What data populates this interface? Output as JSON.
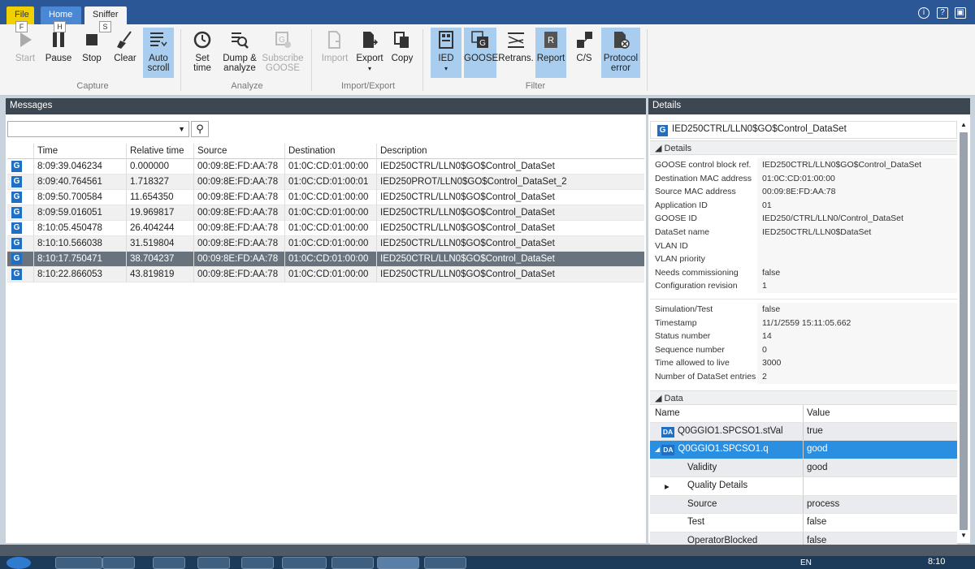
{
  "tabs": {
    "file": "File",
    "home": "Home",
    "sniffer": "Sniffer"
  },
  "keytips": {
    "file": "F",
    "home": "H",
    "sniffer": "S"
  },
  "top_icons": {
    "info": "i",
    "help": "?",
    "window": "▣"
  },
  "ribbon": {
    "capture": {
      "label": "Capture",
      "start": "Start",
      "pause": "Pause",
      "stop": "Stop",
      "clear": "Clear",
      "autoscroll_1": "Auto",
      "autoscroll_2": "scroll"
    },
    "analyze": {
      "label": "Analyze",
      "settime_1": "Set",
      "settime_2": "time",
      "dump_1": "Dump &",
      "dump_2": "analyze",
      "subscribe_1": "Subscribe",
      "subscribe_2": "GOOSE"
    },
    "importexport": {
      "label": "Import/Export",
      "import": "Import",
      "export": "Export",
      "copy": "Copy"
    },
    "filter": {
      "label": "Filter",
      "ied": "IED",
      "goose": "GOOSE",
      "retrans": "Retrans.",
      "report": "Report",
      "cs": "C/S",
      "protocol_1": "Protocol",
      "protocol_2": "error"
    }
  },
  "messages": {
    "title": "Messages",
    "filter_value": "",
    "columns": [
      "Time",
      "Relative time",
      "Source",
      "Destination",
      "Description"
    ],
    "rows": [
      {
        "icon": "G",
        "time": "8:09:39.046234",
        "rel": "0.000000",
        "src": "00:09:8E:FD:AA:78",
        "dst": "01:0C:CD:01:00:00",
        "desc": "IED250CTRL/LLN0$GO$Control_DataSet"
      },
      {
        "icon": "G",
        "time": "8:09:40.764561",
        "rel": "1.718327",
        "src": "00:09:8E:FD:AA:78",
        "dst": "01:0C:CD:01:00:01",
        "desc": "IED250PROT/LLN0$GO$Control_DataSet_2"
      },
      {
        "icon": "G",
        "time": "8:09:50.700584",
        "rel": "11.654350",
        "src": "00:09:8E:FD:AA:78",
        "dst": "01:0C:CD:01:00:00",
        "desc": "IED250CTRL/LLN0$GO$Control_DataSet"
      },
      {
        "icon": "G",
        "time": "8:09:59.016051",
        "rel": "19.969817",
        "src": "00:09:8E:FD:AA:78",
        "dst": "01:0C:CD:01:00:00",
        "desc": "IED250CTRL/LLN0$GO$Control_DataSet"
      },
      {
        "icon": "G",
        "time": "8:10:05.450478",
        "rel": "26.404244",
        "src": "00:09:8E:FD:AA:78",
        "dst": "01:0C:CD:01:00:00",
        "desc": "IED250CTRL/LLN0$GO$Control_DataSet"
      },
      {
        "icon": "G",
        "time": "8:10:10.566038",
        "rel": "31.519804",
        "src": "00:09:8E:FD:AA:78",
        "dst": "01:0C:CD:01:00:00",
        "desc": "IED250CTRL/LLN0$GO$Control_DataSet"
      },
      {
        "icon": "G",
        "time": "8:10:17.750471",
        "rel": "38.704237",
        "src": "00:09:8E:FD:AA:78",
        "dst": "01:0C:CD:01:00:00",
        "desc": "IED250CTRL/LLN0$GO$Control_DataSet"
      },
      {
        "icon": "G",
        "time": "8:10:22.866053",
        "rel": "43.819819",
        "src": "00:09:8E:FD:AA:78",
        "dst": "01:0C:CD:01:00:00",
        "desc": "IED250CTRL/LLN0$GO$Control_DataSet"
      }
    ]
  },
  "details": {
    "title": "Details",
    "header_icon": "G",
    "header": "IED250CTRL/LLN0$GO$Control_DataSet",
    "section_details": "Details",
    "props1": [
      {
        "k": "GOOSE control block ref.",
        "v": "IED250CTRL/LLN0$GO$Control_DataSet"
      },
      {
        "k": "Destination MAC address",
        "v": "01:0C:CD:01:00:00"
      },
      {
        "k": "Source MAC address",
        "v": "00:09:8E:FD:AA:78"
      },
      {
        "k": "Application ID",
        "v": "01"
      },
      {
        "k": "GOOSE ID",
        "v": "IED250/CTRL/LLN0/Control_DataSet"
      },
      {
        "k": "DataSet name",
        "v": "IED250CTRL/LLN0$DataSet"
      },
      {
        "k": "VLAN ID",
        "v": ""
      },
      {
        "k": "VLAN priority",
        "v": ""
      },
      {
        "k": "Needs commissioning",
        "v": "false"
      },
      {
        "k": "Configuration revision",
        "v": "1"
      }
    ],
    "props2": [
      {
        "k": "Simulation/Test",
        "v": "false"
      },
      {
        "k": "Timestamp",
        "v": "11/1/2559 15:11:05.662"
      },
      {
        "k": "Status number",
        "v": "14"
      },
      {
        "k": "Sequence number",
        "v": "0"
      },
      {
        "k": "Time allowed to live",
        "v": "3000"
      },
      {
        "k": "Number of DataSet entries",
        "v": "2"
      }
    ],
    "section_data": "Data",
    "data_cols": {
      "name": "Name",
      "value": "Value"
    },
    "data_rows": [
      {
        "tag": "DA",
        "name": "Q0GGIO1.SPCSO1.stVal",
        "value": "true"
      },
      {
        "tag": "DA",
        "name": "Q0GGIO1.SPCSO1.q",
        "value": "good"
      },
      {
        "tag": "",
        "name": "Validity",
        "value": "good"
      },
      {
        "tag": "",
        "name": "Quality Details",
        "value": ""
      },
      {
        "tag": "",
        "name": "Source",
        "value": "process"
      },
      {
        "tag": "",
        "name": "Test",
        "value": "false"
      },
      {
        "tag": "",
        "name": "OperatorBlocked",
        "value": "false"
      }
    ]
  },
  "taskbar": {
    "lang": "EN",
    "clock": "8:10"
  }
}
